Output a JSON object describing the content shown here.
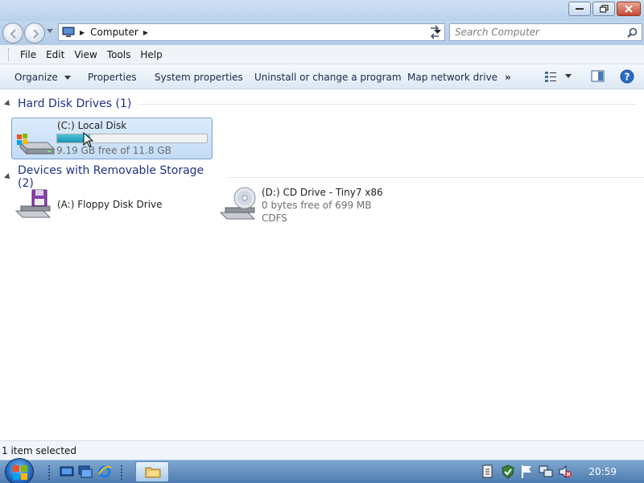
{
  "window": {
    "controls": {
      "minimize_icon": "minimize-icon",
      "maximize_icon": "restore-icon",
      "close_icon": "close-icon"
    }
  },
  "address": {
    "breadcrumb": "Computer",
    "search_placeholder": "Search Computer"
  },
  "menu": {
    "items": [
      "File",
      "Edit",
      "View",
      "Tools",
      "Help"
    ]
  },
  "commands": {
    "organize": "Organize",
    "properties": "Properties",
    "system_properties": "System properties",
    "uninstall": "Uninstall or change a program",
    "map_drive": "Map network drive",
    "more": "»"
  },
  "groups": {
    "hard_disks": {
      "title": "Hard Disk Drives (1)",
      "drives": [
        {
          "name": "(C:) Local Disk",
          "free": "9.19 GB free of 11.8 GB",
          "used_fraction": 0.22
        }
      ]
    },
    "removable": {
      "title": "Devices with Removable Storage (2)",
      "drives": [
        {
          "name": "(A:) Floppy Disk Drive"
        },
        {
          "name": "(D:) CD Drive - Tiny7 x86",
          "free": "0 bytes free of 699 MB",
          "fs": "CDFS"
        }
      ]
    }
  },
  "status": {
    "text": "1 item selected"
  },
  "taskbar": {
    "clock": "20:59"
  },
  "colors": {
    "accent": "#1e3287",
    "selection": "#c3dcf5",
    "capacity_bar": "#26a6c2"
  }
}
